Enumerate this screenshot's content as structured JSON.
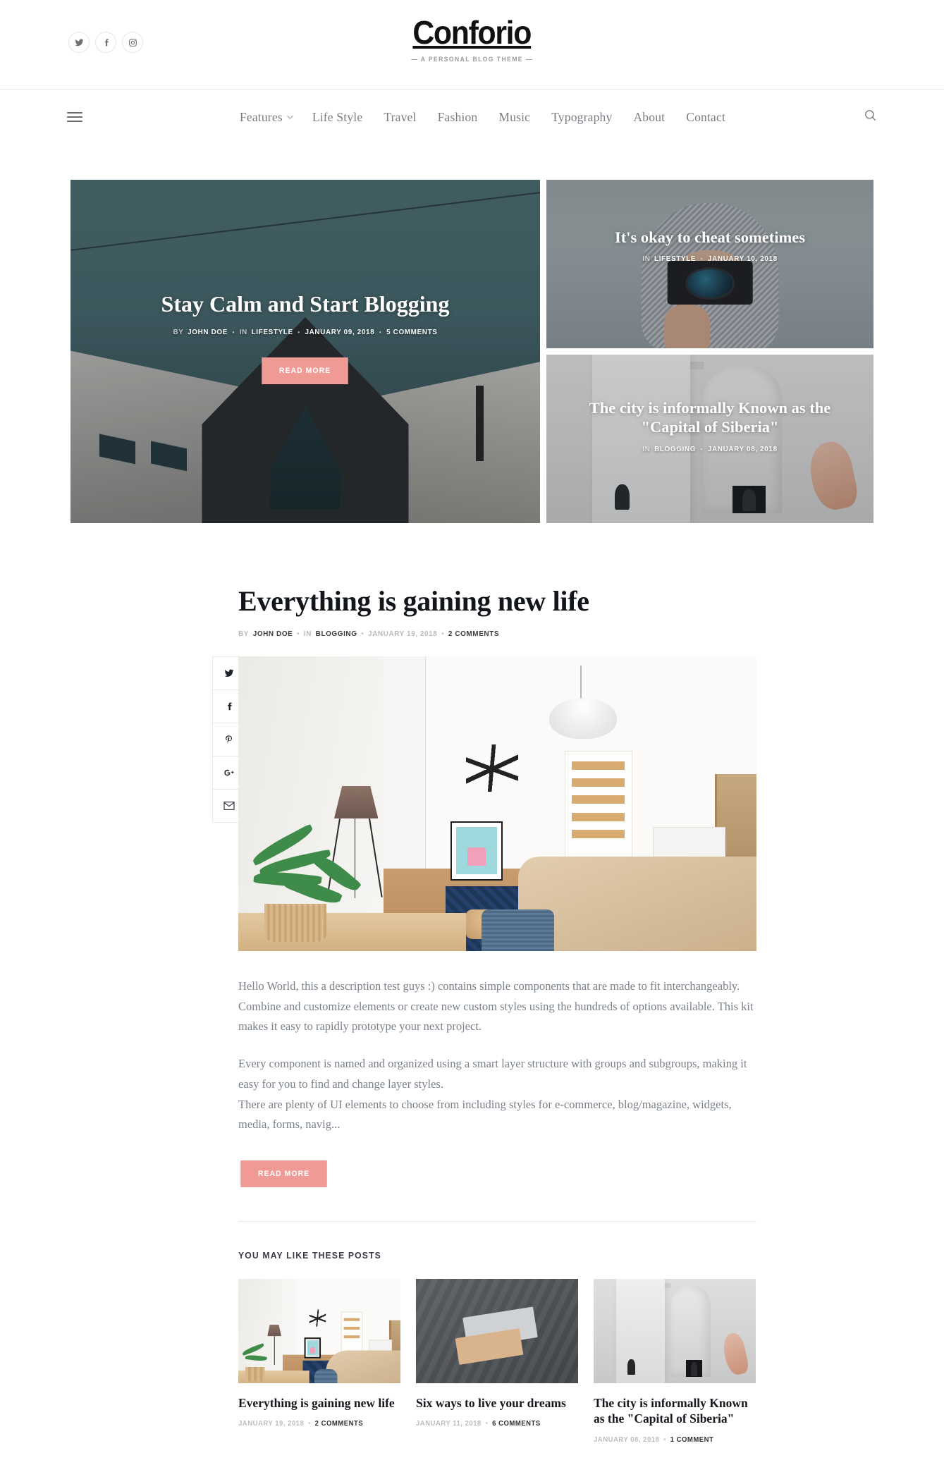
{
  "site": {
    "logo": "Conforio",
    "tagline": "— A PERSONAL BLOG THEME —",
    "accent_color": "#ef9a95"
  },
  "social": [
    {
      "name": "twitter-icon",
      "label": "Twitter"
    },
    {
      "name": "facebook-icon",
      "label": "Facebook"
    },
    {
      "name": "instagram-icon",
      "label": "Instagram"
    }
  ],
  "nav": {
    "items": [
      {
        "label": "Features",
        "has_dropdown": true
      },
      {
        "label": "Life Style",
        "has_dropdown": false
      },
      {
        "label": "Travel",
        "has_dropdown": false
      },
      {
        "label": "Fashion",
        "has_dropdown": false
      },
      {
        "label": "Music",
        "has_dropdown": false
      },
      {
        "label": "Typography",
        "has_dropdown": false
      },
      {
        "label": "About",
        "has_dropdown": false
      },
      {
        "label": "Contact",
        "has_dropdown": false
      }
    ]
  },
  "hero": {
    "main": {
      "title": "Stay Calm and Start Blogging",
      "by_label": "BY",
      "author": "JOHN DOE",
      "in_label": "IN",
      "category": "LIFESTYLE",
      "date": "JANUARY 09, 2018",
      "comments": "5 COMMENTS",
      "button": "READ MORE"
    },
    "cards": [
      {
        "title": "It's okay to cheat sometimes",
        "in_label": "IN",
        "category": "LIFESTYLE",
        "date": "JANUARY 10, 2018"
      },
      {
        "title": "The city is informally Known as the \"Capital of Siberia\"",
        "in_label": "IN",
        "category": "BLOGGING",
        "date": "JANUARY 08, 2018"
      }
    ]
  },
  "post": {
    "title": "Everything is gaining new life",
    "by_label": "BY",
    "author": "JOHN DOE",
    "in_label": "IN",
    "category": "BLOGGING",
    "date": "JANUARY 19, 2018",
    "comments": "2 COMMENTS",
    "paragraphs": [
      "Hello World, this a description test guys :) contains simple components that are made to fit interchangeably. Combine and customize elements or create new custom styles using the hundreds of options available. This kit makes it easy to rapidly prototype your next project.",
      "Every component is named and organized using a smart layer structure with groups and subgroups, making it easy for you to find and change layer styles.\nThere are plenty of UI elements to choose from including styles for e-commerce, blog/magazine, widgets, media, forms, navig..."
    ],
    "read_more": "READ MORE"
  },
  "share": [
    {
      "name": "twitter-icon",
      "label": "Share on Twitter"
    },
    {
      "name": "facebook-icon",
      "label": "Share on Facebook"
    },
    {
      "name": "pinterest-icon",
      "label": "Share on Pinterest"
    },
    {
      "name": "google-plus-icon",
      "label": "Share on Google Plus"
    },
    {
      "name": "email-icon",
      "label": "Share by Email"
    }
  ],
  "related": {
    "heading": "YOU MAY LIKE THESE POSTS",
    "posts": [
      {
        "title": "Everything is gaining new life",
        "date": "JANUARY 19, 2018",
        "comments": "2 COMMENTS"
      },
      {
        "title": "Six ways to live your dreams",
        "date": "JANUARY 11, 2018",
        "comments": "6 COMMENTS"
      },
      {
        "title": "The city is informally Known as the \"Capital of Siberia\"",
        "date": "JANUARY 08, 2018",
        "comments": "1 COMMENT"
      }
    ]
  }
}
